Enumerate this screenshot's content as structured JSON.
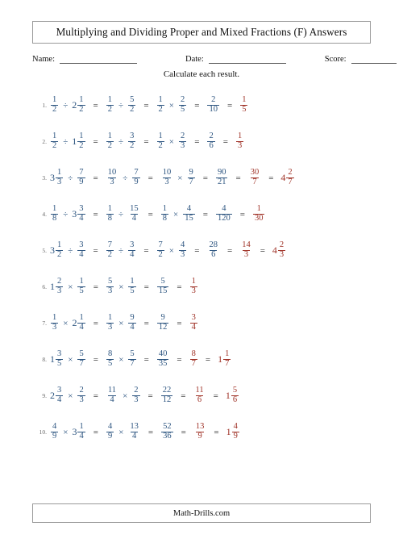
{
  "worksheet": {
    "title": "Multiplying and Dividing Proper and Mixed Fractions (F) Answers",
    "instruction": "Calculate each result.",
    "footer": "Math-Drills.com"
  },
  "meta": {
    "name_label": "Name:",
    "date_label": "Date:",
    "score_label": "Score:"
  },
  "colors": {
    "problem_blue": "#2d5580",
    "answer_red": "#a03328",
    "text_dark": "#1a1a1a",
    "border_gray": "#9a9a9a"
  },
  "problems": [
    {
      "number": "1.",
      "operator": "÷",
      "steps": [
        {
          "kind": "pair",
          "color": "blue",
          "op": "÷",
          "left": {
            "type": "fraction",
            "num": "1",
            "den": "2"
          },
          "right": {
            "type": "mixed",
            "whole": "2",
            "num": "1",
            "den": "2"
          }
        },
        {
          "kind": "pair",
          "color": "blue",
          "op": "÷",
          "left": {
            "type": "fraction",
            "num": "1",
            "den": "2"
          },
          "right": {
            "type": "fraction",
            "num": "5",
            "den": "2"
          }
        },
        {
          "kind": "pair",
          "color": "blue",
          "op": "×",
          "left": {
            "type": "fraction",
            "num": "1",
            "den": "2"
          },
          "right": {
            "type": "fraction",
            "num": "2",
            "den": "5"
          }
        },
        {
          "kind": "single",
          "color": "blue",
          "value": {
            "type": "fraction",
            "num": "2",
            "den": "10"
          }
        },
        {
          "kind": "single",
          "color": "red",
          "value": {
            "type": "fraction",
            "num": "1",
            "den": "5"
          }
        }
      ]
    },
    {
      "number": "2.",
      "operator": "÷",
      "steps": [
        {
          "kind": "pair",
          "color": "blue",
          "op": "÷",
          "left": {
            "type": "fraction",
            "num": "1",
            "den": "2"
          },
          "right": {
            "type": "mixed",
            "whole": "1",
            "num": "1",
            "den": "2"
          }
        },
        {
          "kind": "pair",
          "color": "blue",
          "op": "÷",
          "left": {
            "type": "fraction",
            "num": "1",
            "den": "2"
          },
          "right": {
            "type": "fraction",
            "num": "3",
            "den": "2"
          }
        },
        {
          "kind": "pair",
          "color": "blue",
          "op": "×",
          "left": {
            "type": "fraction",
            "num": "1",
            "den": "2"
          },
          "right": {
            "type": "fraction",
            "num": "2",
            "den": "3"
          }
        },
        {
          "kind": "single",
          "color": "blue",
          "value": {
            "type": "fraction",
            "num": "2",
            "den": "6"
          }
        },
        {
          "kind": "single",
          "color": "red",
          "value": {
            "type": "fraction",
            "num": "1",
            "den": "3"
          }
        }
      ]
    },
    {
      "number": "3.",
      "operator": "÷",
      "steps": [
        {
          "kind": "pair",
          "color": "blue",
          "op": "÷",
          "left": {
            "type": "mixed",
            "whole": "3",
            "num": "1",
            "den": "3"
          },
          "right": {
            "type": "fraction",
            "num": "7",
            "den": "9"
          }
        },
        {
          "kind": "pair",
          "color": "blue",
          "op": "÷",
          "left": {
            "type": "fraction",
            "num": "10",
            "den": "3"
          },
          "right": {
            "type": "fraction",
            "num": "7",
            "den": "9"
          }
        },
        {
          "kind": "pair",
          "color": "blue",
          "op": "×",
          "left": {
            "type": "fraction",
            "num": "10",
            "den": "3"
          },
          "right": {
            "type": "fraction",
            "num": "9",
            "den": "7"
          }
        },
        {
          "kind": "single",
          "color": "blue",
          "value": {
            "type": "fraction",
            "num": "90",
            "den": "21"
          }
        },
        {
          "kind": "single",
          "color": "red",
          "value": {
            "type": "fraction",
            "num": "30",
            "den": "7"
          }
        },
        {
          "kind": "single",
          "color": "red",
          "value": {
            "type": "mixed",
            "whole": "4",
            "num": "2",
            "den": "7"
          }
        }
      ]
    },
    {
      "number": "4.",
      "operator": "÷",
      "steps": [
        {
          "kind": "pair",
          "color": "blue",
          "op": "÷",
          "left": {
            "type": "fraction",
            "num": "1",
            "den": "8"
          },
          "right": {
            "type": "mixed",
            "whole": "3",
            "num": "3",
            "den": "4"
          }
        },
        {
          "kind": "pair",
          "color": "blue",
          "op": "÷",
          "left": {
            "type": "fraction",
            "num": "1",
            "den": "8"
          },
          "right": {
            "type": "fraction",
            "num": "15",
            "den": "4"
          }
        },
        {
          "kind": "pair",
          "color": "blue",
          "op": "×",
          "left": {
            "type": "fraction",
            "num": "1",
            "den": "8"
          },
          "right": {
            "type": "fraction",
            "num": "4",
            "den": "15"
          }
        },
        {
          "kind": "single",
          "color": "blue",
          "value": {
            "type": "fraction",
            "num": "4",
            "den": "120"
          }
        },
        {
          "kind": "single",
          "color": "red",
          "value": {
            "type": "fraction",
            "num": "1",
            "den": "30"
          }
        }
      ]
    },
    {
      "number": "5.",
      "operator": "÷",
      "steps": [
        {
          "kind": "pair",
          "color": "blue",
          "op": "÷",
          "left": {
            "type": "mixed",
            "whole": "3",
            "num": "1",
            "den": "2"
          },
          "right": {
            "type": "fraction",
            "num": "3",
            "den": "4"
          }
        },
        {
          "kind": "pair",
          "color": "blue",
          "op": "÷",
          "left": {
            "type": "fraction",
            "num": "7",
            "den": "2"
          },
          "right": {
            "type": "fraction",
            "num": "3",
            "den": "4"
          }
        },
        {
          "kind": "pair",
          "color": "blue",
          "op": "×",
          "left": {
            "type": "fraction",
            "num": "7",
            "den": "2"
          },
          "right": {
            "type": "fraction",
            "num": "4",
            "den": "3"
          }
        },
        {
          "kind": "single",
          "color": "blue",
          "value": {
            "type": "fraction",
            "num": "28",
            "den": "6"
          }
        },
        {
          "kind": "single",
          "color": "red",
          "value": {
            "type": "fraction",
            "num": "14",
            "den": "3"
          }
        },
        {
          "kind": "single",
          "color": "red",
          "value": {
            "type": "mixed",
            "whole": "4",
            "num": "2",
            "den": "3"
          }
        }
      ]
    },
    {
      "number": "6.",
      "operator": "×",
      "steps": [
        {
          "kind": "pair",
          "color": "blue",
          "op": "×",
          "left": {
            "type": "mixed",
            "whole": "1",
            "num": "2",
            "den": "3"
          },
          "right": {
            "type": "fraction",
            "num": "1",
            "den": "5"
          }
        },
        {
          "kind": "pair",
          "color": "blue",
          "op": "×",
          "left": {
            "type": "fraction",
            "num": "5",
            "den": "3"
          },
          "right": {
            "type": "fraction",
            "num": "1",
            "den": "5"
          }
        },
        {
          "kind": "single",
          "color": "blue",
          "value": {
            "type": "fraction",
            "num": "5",
            "den": "15"
          }
        },
        {
          "kind": "single",
          "color": "red",
          "value": {
            "type": "fraction",
            "num": "1",
            "den": "3"
          }
        }
      ]
    },
    {
      "number": "7.",
      "operator": "×",
      "steps": [
        {
          "kind": "pair",
          "color": "blue",
          "op": "×",
          "left": {
            "type": "fraction",
            "num": "1",
            "den": "3"
          },
          "right": {
            "type": "mixed",
            "whole": "2",
            "num": "1",
            "den": "4"
          }
        },
        {
          "kind": "pair",
          "color": "blue",
          "op": "×",
          "left": {
            "type": "fraction",
            "num": "1",
            "den": "3"
          },
          "right": {
            "type": "fraction",
            "num": "9",
            "den": "4"
          }
        },
        {
          "kind": "single",
          "color": "blue",
          "value": {
            "type": "fraction",
            "num": "9",
            "den": "12"
          }
        },
        {
          "kind": "single",
          "color": "red",
          "value": {
            "type": "fraction",
            "num": "3",
            "den": "4"
          }
        }
      ]
    },
    {
      "number": "8.",
      "operator": "×",
      "steps": [
        {
          "kind": "pair",
          "color": "blue",
          "op": "×",
          "left": {
            "type": "mixed",
            "whole": "1",
            "num": "3",
            "den": "5"
          },
          "right": {
            "type": "fraction",
            "num": "5",
            "den": "7"
          }
        },
        {
          "kind": "pair",
          "color": "blue",
          "op": "×",
          "left": {
            "type": "fraction",
            "num": "8",
            "den": "5"
          },
          "right": {
            "type": "fraction",
            "num": "5",
            "den": "7"
          }
        },
        {
          "kind": "single",
          "color": "blue",
          "value": {
            "type": "fraction",
            "num": "40",
            "den": "35"
          }
        },
        {
          "kind": "single",
          "color": "red",
          "value": {
            "type": "fraction",
            "num": "8",
            "den": "7"
          }
        },
        {
          "kind": "single",
          "color": "red",
          "value": {
            "type": "mixed",
            "whole": "1",
            "num": "1",
            "den": "7"
          }
        }
      ]
    },
    {
      "number": "9.",
      "operator": "×",
      "steps": [
        {
          "kind": "pair",
          "color": "blue",
          "op": "×",
          "left": {
            "type": "mixed",
            "whole": "2",
            "num": "3",
            "den": "4"
          },
          "right": {
            "type": "fraction",
            "num": "2",
            "den": "3"
          }
        },
        {
          "kind": "pair",
          "color": "blue",
          "op": "×",
          "left": {
            "type": "fraction",
            "num": "11",
            "den": "4"
          },
          "right": {
            "type": "fraction",
            "num": "2",
            "den": "3"
          }
        },
        {
          "kind": "single",
          "color": "blue",
          "value": {
            "type": "fraction",
            "num": "22",
            "den": "12"
          }
        },
        {
          "kind": "single",
          "color": "red",
          "value": {
            "type": "fraction",
            "num": "11",
            "den": "6"
          }
        },
        {
          "kind": "single",
          "color": "red",
          "value": {
            "type": "mixed",
            "whole": "1",
            "num": "5",
            "den": "6"
          }
        }
      ]
    },
    {
      "number": "10.",
      "operator": "×",
      "steps": [
        {
          "kind": "pair",
          "color": "blue",
          "op": "×",
          "left": {
            "type": "fraction",
            "num": "4",
            "den": "9"
          },
          "right": {
            "type": "mixed",
            "whole": "3",
            "num": "1",
            "den": "4"
          }
        },
        {
          "kind": "pair",
          "color": "blue",
          "op": "×",
          "left": {
            "type": "fraction",
            "num": "4",
            "den": "9"
          },
          "right": {
            "type": "fraction",
            "num": "13",
            "den": "4"
          }
        },
        {
          "kind": "single",
          "color": "blue",
          "value": {
            "type": "fraction",
            "num": "52",
            "den": "36"
          }
        },
        {
          "kind": "single",
          "color": "red",
          "value": {
            "type": "fraction",
            "num": "13",
            "den": "9"
          }
        },
        {
          "kind": "single",
          "color": "red",
          "value": {
            "type": "mixed",
            "whole": "1",
            "num": "4",
            "den": "9"
          }
        }
      ]
    }
  ]
}
